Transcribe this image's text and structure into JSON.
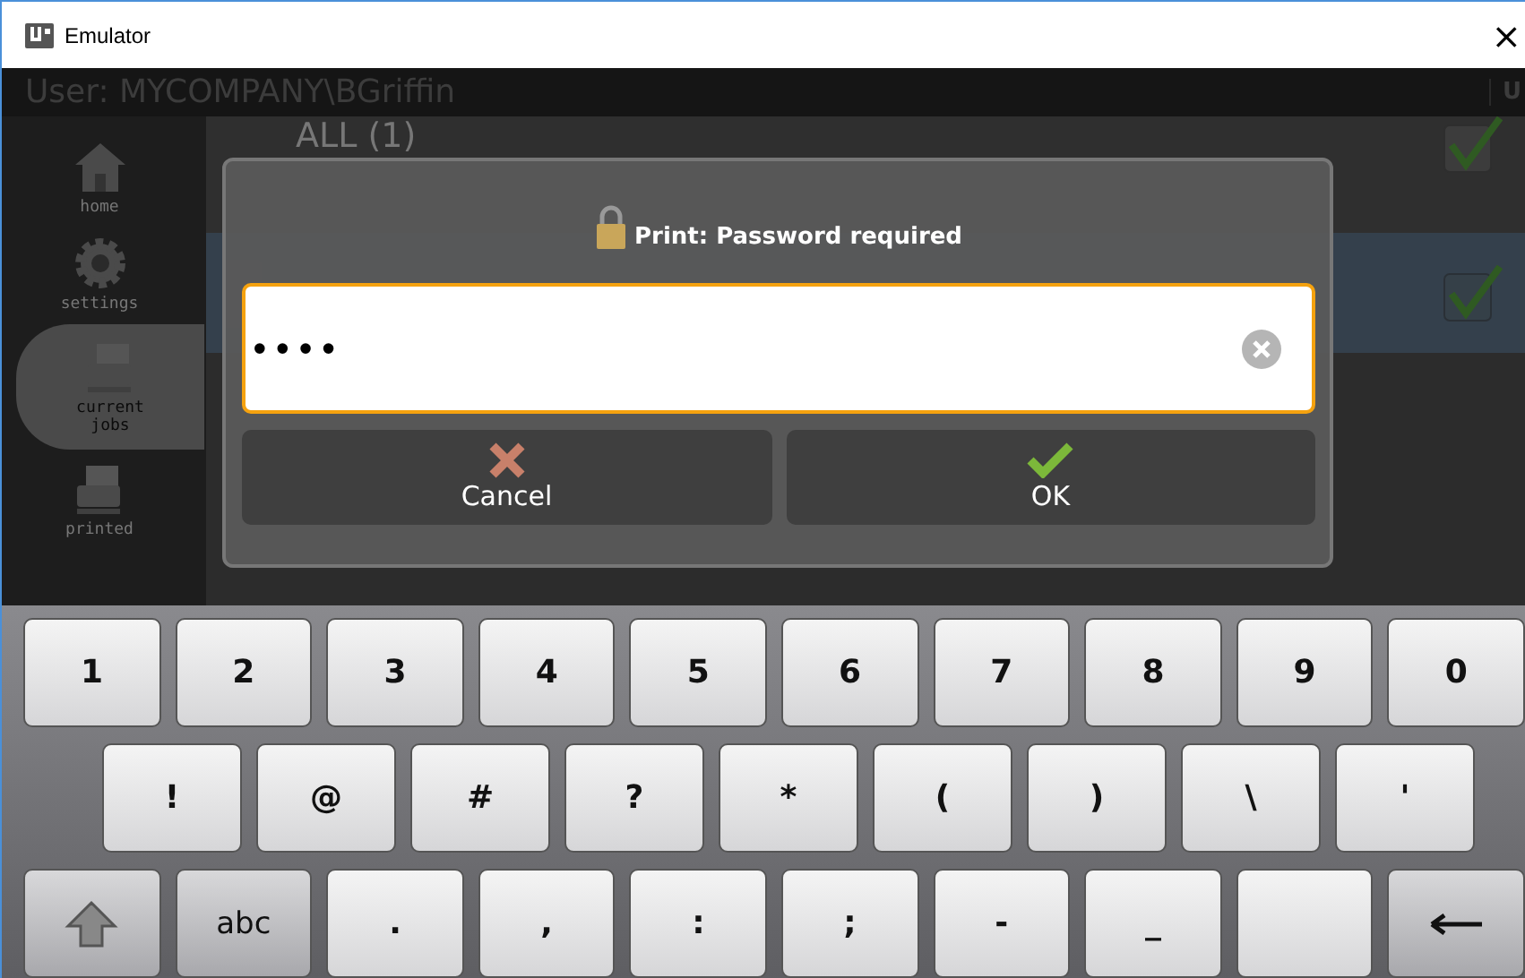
{
  "window": {
    "title": "Emulator",
    "close": "×"
  },
  "header": {
    "user": "User: MYCOMPANY\\BGriffin",
    "logo": "U"
  },
  "sidebar": {
    "items": [
      {
        "kind": "home",
        "label": "home",
        "selected": false
      },
      {
        "kind": "settings",
        "label": "settings",
        "selected": false
      },
      {
        "kind": "current",
        "label": "current jobs",
        "selected": true
      },
      {
        "kind": "printed",
        "label": "printed",
        "selected": false
      }
    ]
  },
  "jobs": {
    "title": "ALL (1)",
    "all_checked": true,
    "items": [
      {
        "checked": true,
        "selected": true
      }
    ]
  },
  "dialog": {
    "title": "Print: Password required",
    "password": {
      "value": "••••"
    },
    "buttons": [
      {
        "kind": "cancel",
        "label": "Cancel"
      },
      {
        "kind": "ok",
        "label": "OK"
      }
    ]
  },
  "keyboard": {
    "rows": [
      [
        {
          "kind": "char",
          "label": "1"
        },
        {
          "kind": "char",
          "label": "2"
        },
        {
          "kind": "char",
          "label": "3"
        },
        {
          "kind": "char",
          "label": "4"
        },
        {
          "kind": "char",
          "label": "5"
        },
        {
          "kind": "char",
          "label": "6"
        },
        {
          "kind": "char",
          "label": "7"
        },
        {
          "kind": "char",
          "label": "8"
        },
        {
          "kind": "char",
          "label": "9"
        },
        {
          "kind": "char",
          "label": "0"
        }
      ],
      [
        {
          "kind": "char",
          "label": "!"
        },
        {
          "kind": "char",
          "label": "@"
        },
        {
          "kind": "char",
          "label": "#"
        },
        {
          "kind": "char",
          "label": "?"
        },
        {
          "kind": "char",
          "label": "*"
        },
        {
          "kind": "char",
          "label": "("
        },
        {
          "kind": "char",
          "label": ")"
        },
        {
          "kind": "char",
          "label": "\\"
        },
        {
          "kind": "char",
          "label": "'"
        }
      ],
      [
        {
          "kind": "shift"
        },
        {
          "kind": "mode",
          "label": "abc"
        },
        {
          "kind": "char",
          "label": "."
        },
        {
          "kind": "char",
          "label": ","
        },
        {
          "kind": "char",
          "label": ":"
        },
        {
          "kind": "char",
          "label": ";"
        },
        {
          "kind": "char",
          "label": "-"
        },
        {
          "kind": "char",
          "label": "_"
        },
        {
          "kind": "space"
        },
        {
          "kind": "backspace"
        }
      ]
    ]
  }
}
